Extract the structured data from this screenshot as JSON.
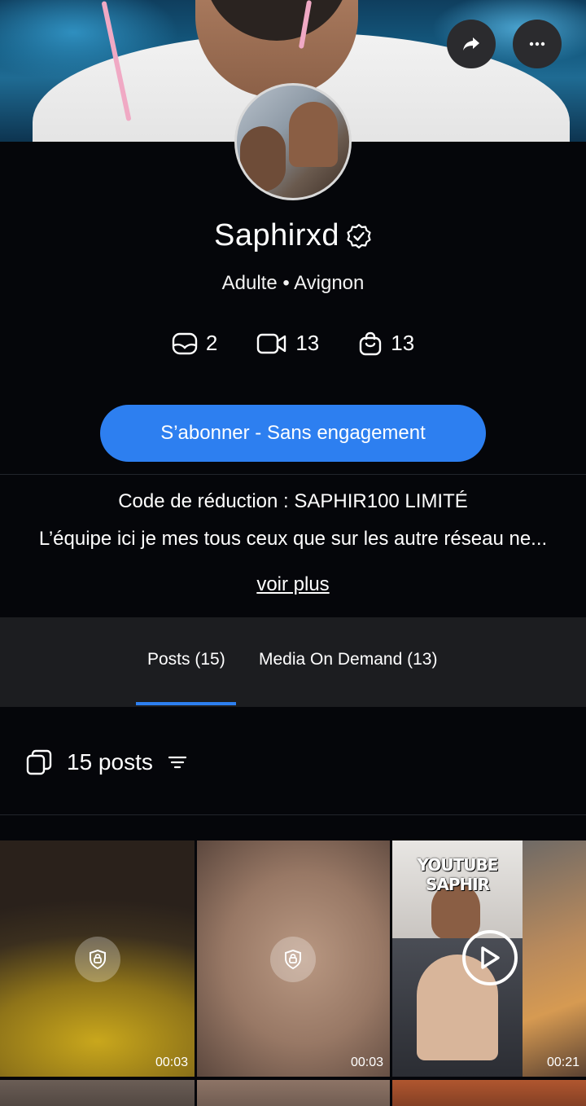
{
  "header": {
    "share_icon": "share-arrow-icon",
    "more_icon": "more-dots-icon"
  },
  "profile": {
    "name": "Saphirxd",
    "verified_icon": "verified-badge-icon",
    "subtitle": "Adulte • Avignon",
    "stats": [
      {
        "icon": "posts-icon",
        "value": "2"
      },
      {
        "icon": "video-icon",
        "value": "13"
      },
      {
        "icon": "shopping-bag-icon",
        "value": "13"
      }
    ],
    "subscribe_label": "S’abonner - Sans engagement"
  },
  "bio": {
    "line1": "Code de réduction : SAPHIR100 LIMITÉ",
    "line2": "L’équipe ici je mes tous ceux que sur les autre réseau ne...",
    "see_more": "voir plus"
  },
  "tabs": [
    {
      "label": "Posts (15)",
      "active": true
    },
    {
      "label": "Media On Demand (13)",
      "active": false
    }
  ],
  "posts_header": {
    "count_label": "15 posts",
    "filter_icon": "filter-icon"
  },
  "grid": [
    {
      "duration": "00:03",
      "locked": true
    },
    {
      "duration": "00:03",
      "locked": true
    },
    {
      "duration": "00:21",
      "locked": false,
      "banner": "YOUTUBE SAPHIR"
    }
  ],
  "colors": {
    "accent": "#2d7ff0",
    "background": "#05060a",
    "tabs_background": "#1c1d20"
  }
}
